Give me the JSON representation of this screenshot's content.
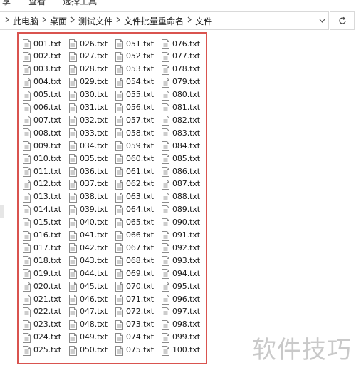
{
  "ribbon": {
    "items": [
      "享",
      "查看",
      "选择工具"
    ]
  },
  "breadcrumb": {
    "items": [
      "此电脑",
      "桌面",
      "测试文件",
      "文件批量重命名",
      "文件"
    ]
  },
  "files": [
    "001.txt",
    "002.txt",
    "003.txt",
    "004.txt",
    "005.txt",
    "006.txt",
    "007.txt",
    "008.txt",
    "009.txt",
    "010.txt",
    "011.txt",
    "012.txt",
    "013.txt",
    "014.txt",
    "015.txt",
    "016.txt",
    "017.txt",
    "018.txt",
    "019.txt",
    "020.txt",
    "021.txt",
    "022.txt",
    "023.txt",
    "024.txt",
    "025.txt",
    "026.txt",
    "027.txt",
    "028.txt",
    "029.txt",
    "030.txt",
    "031.txt",
    "032.txt",
    "033.txt",
    "034.txt",
    "035.txt",
    "036.txt",
    "037.txt",
    "038.txt",
    "039.txt",
    "040.txt",
    "041.txt",
    "042.txt",
    "043.txt",
    "044.txt",
    "045.txt",
    "046.txt",
    "047.txt",
    "048.txt",
    "049.txt",
    "050.txt",
    "051.txt",
    "052.txt",
    "053.txt",
    "054.txt",
    "055.txt",
    "056.txt",
    "057.txt",
    "058.txt",
    "059.txt",
    "060.txt",
    "061.txt",
    "062.txt",
    "063.txt",
    "064.txt",
    "065.txt",
    "066.txt",
    "067.txt",
    "068.txt",
    "069.txt",
    "070.txt",
    "071.txt",
    "072.txt",
    "073.txt",
    "074.txt",
    "075.txt",
    "076.txt",
    "077.txt",
    "078.txt",
    "079.txt",
    "080.txt",
    "081.txt",
    "082.txt",
    "083.txt",
    "084.txt",
    "085.txt",
    "086.txt",
    "087.txt",
    "088.txt",
    "089.txt",
    "090.txt",
    "091.txt",
    "092.txt",
    "093.txt",
    "094.txt",
    "095.txt",
    "096.txt",
    "097.txt",
    "098.txt",
    "099.txt",
    "100.txt"
  ],
  "watermark": "软件技巧",
  "icons": {
    "file": "text-file-icon",
    "refresh": "refresh-icon",
    "dropdown": "chevron-down-icon",
    "separator": "chevron-right-icon"
  },
  "colors": {
    "highlight_border": "#d9534f",
    "watermark": "#c9c9c9"
  }
}
